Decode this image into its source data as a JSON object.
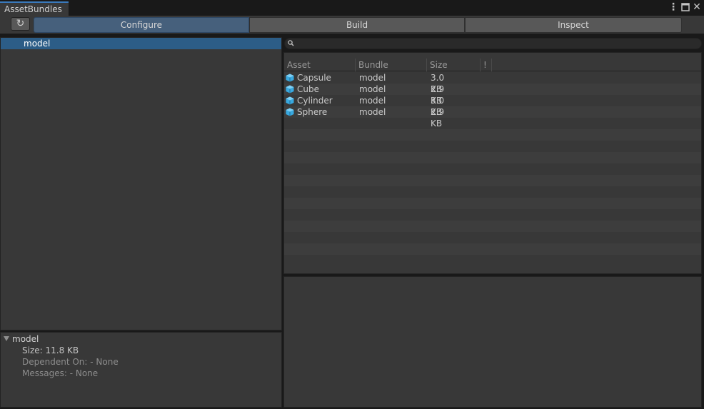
{
  "window": {
    "title": "AssetBundles"
  },
  "toolbar": {
    "tabs": [
      {
        "label": "Configure",
        "selected": true
      },
      {
        "label": "Build",
        "selected": false
      },
      {
        "label": "Inspect",
        "selected": false
      }
    ]
  },
  "bundles": {
    "items": [
      {
        "label": "model"
      }
    ]
  },
  "details": {
    "title": "model",
    "size": "Size: 11.8 KB",
    "dependent_on": "Dependent On: - None",
    "messages": "Messages: - None"
  },
  "search": {
    "value": ""
  },
  "table": {
    "columns": [
      "Asset",
      "Bundle",
      "Size",
      "!"
    ],
    "rows": [
      {
        "asset": "Capsule",
        "bundle": "model",
        "size": "3.0 KB",
        "icon": "prefab-cube-icon"
      },
      {
        "asset": "Cube",
        "bundle": "model",
        "size": "2.9 KB",
        "icon": "prefab-cube-icon"
      },
      {
        "asset": "Cylinder",
        "bundle": "model",
        "size": "3.0 KB",
        "icon": "prefab-cube-icon"
      },
      {
        "asset": "Sphere",
        "bundle": "model",
        "size": "2.9 KB",
        "icon": "prefab-cube-icon"
      }
    ]
  },
  "colors": {
    "accent": "#3a79bb",
    "selection": "#2c5d87",
    "selected_tab": "#46607c",
    "panel": "#383838",
    "icon": "#39a9e0"
  }
}
